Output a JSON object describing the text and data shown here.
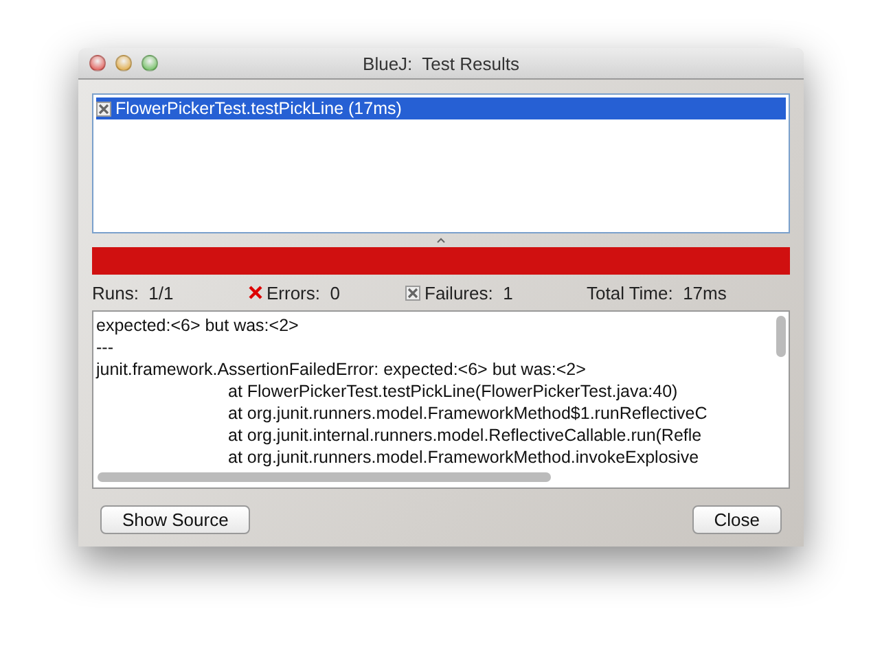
{
  "window": {
    "title": "BlueJ:  Test Results"
  },
  "tests": [
    {
      "name": "FlowerPickerTest.testPickLine (17ms)",
      "kind": "failure",
      "selected": true
    }
  ],
  "result_bar": {
    "kind": "failure"
  },
  "counters": [
    {
      "label": "Runs:",
      "value": "1/1"
    },
    {
      "label": "Errors:",
      "value": "0",
      "kind": "error"
    },
    {
      "label": "Failures:",
      "value": "1",
      "kind": "failure"
    },
    {
      "label": "Total Time:",
      "value": "17ms"
    }
  ],
  "trace": {
    "lines": [
      {
        "text": "expected:<6> but was:<2>",
        "indented": false
      },
      {
        "text": "---",
        "indented": false
      },
      {
        "text": "junit.framework.AssertionFailedError: expected:<6> but was:<2>",
        "indented": false
      },
      {
        "text": "at FlowerPickerTest.testPickLine(FlowerPickerTest.java:40)",
        "indented": true
      },
      {
        "text": "at org.junit.runners.model.FrameworkMethod$1.runReflectiveC",
        "indented": true
      },
      {
        "text": "at org.junit.internal.runners.model.ReflectiveCallable.run(Refle",
        "indented": true
      },
      {
        "text": "at org.junit.runners.model.FrameworkMethod.invokeExplosive",
        "indented": true
      }
    ]
  },
  "buttons": [
    {
      "label": "Show Source"
    },
    {
      "label": "Close"
    }
  ]
}
